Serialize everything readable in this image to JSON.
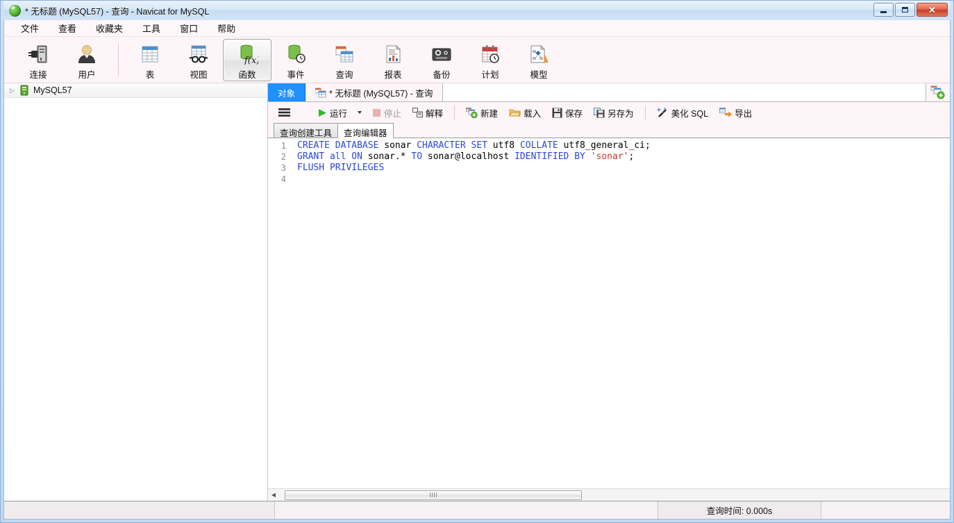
{
  "window": {
    "title": "* 无标题 (MySQL57) - 查询 - Navicat for MySQL",
    "logo_icon": "navicat-green-circle-icon",
    "controls": {
      "minimize": "minimize-icon",
      "maximize": "maximize-icon",
      "close": "close-icon"
    }
  },
  "menubar": {
    "items": [
      {
        "label": "文件"
      },
      {
        "label": "查看"
      },
      {
        "label": "收藏夹"
      },
      {
        "label": "工具"
      },
      {
        "label": "窗口"
      },
      {
        "label": "帮助"
      }
    ]
  },
  "toolbar": {
    "groups": [
      {
        "buttons": [
          {
            "label": "连接",
            "icon": "connection-plug-icon",
            "active": false
          },
          {
            "label": "用户",
            "icon": "user-icon",
            "active": false
          }
        ]
      },
      {
        "buttons": [
          {
            "label": "表",
            "icon": "table-grid-icon",
            "active": false
          },
          {
            "label": "视图",
            "icon": "view-glasses-icon",
            "active": false
          },
          {
            "label": "函数",
            "icon": "function-fx-icon",
            "active": true
          },
          {
            "label": "事件",
            "icon": "event-clock-icon",
            "active": false
          },
          {
            "label": "查询",
            "icon": "query-tables-icon",
            "active": false
          },
          {
            "label": "报表",
            "icon": "report-chart-icon",
            "active": false
          },
          {
            "label": "备份",
            "icon": "backup-tape-icon",
            "active": false
          },
          {
            "label": "计划",
            "icon": "schedule-calendar-icon",
            "active": false
          },
          {
            "label": "模型",
            "icon": "model-diagram-icon",
            "active": false
          }
        ]
      }
    ]
  },
  "sidebar": {
    "tree": [
      {
        "label": "MySQL57",
        "icon": "server-icon",
        "expander": "collapsed-arrow-icon",
        "expanded": false
      }
    ]
  },
  "tabstrip": {
    "tabs": [
      {
        "label": "对象",
        "state": "active-blue",
        "icon": null
      },
      {
        "label": "* 无标题 (MySQL57) - 查询",
        "state": "active-doc",
        "icon": "query-tables-icon"
      }
    ],
    "add_button": {
      "icon": "new-query-plus-icon",
      "title": "新建查询"
    }
  },
  "querybar": {
    "menu_button": {
      "icon": "hamburger-menu-icon"
    },
    "buttons": [
      {
        "label": "运行",
        "icon": "play-green-icon",
        "disabled": false,
        "has_caret": true
      },
      {
        "label": "停止",
        "icon": "stop-square-icon",
        "disabled": true,
        "has_caret": false
      },
      {
        "label": "解释",
        "icon": "explain-icon",
        "disabled": false,
        "has_caret": false
      },
      {
        "label": "新建",
        "icon": "new-doc-plus-icon",
        "disabled": false,
        "has_caret": false
      },
      {
        "label": "载入",
        "icon": "folder-open-icon",
        "disabled": false,
        "has_caret": false
      },
      {
        "label": "保存",
        "icon": "save-floppy-icon",
        "disabled": false,
        "has_caret": false
      },
      {
        "label": "另存为",
        "icon": "save-as-icon",
        "disabled": false,
        "has_caret": false
      },
      {
        "label": "美化 SQL",
        "icon": "magic-wand-icon",
        "disabled": false,
        "has_caret": false
      },
      {
        "label": "导出",
        "icon": "export-arrow-icon",
        "disabled": false,
        "has_caret": false
      }
    ]
  },
  "subtabs": {
    "tabs": [
      {
        "label": "查询创建工具",
        "active": false
      },
      {
        "label": "查询编辑器",
        "active": true
      }
    ]
  },
  "editor": {
    "line_numbers": [
      "1",
      "2",
      "3",
      "4"
    ],
    "lines": [
      {
        "n": 1,
        "tokens": [
          {
            "t": "CREATE",
            "c": "kw"
          },
          {
            "t": " ",
            "c": "pln"
          },
          {
            "t": "DATABASE",
            "c": "kw"
          },
          {
            "t": " sonar ",
            "c": "pln"
          },
          {
            "t": "CHARACTER",
            "c": "kw"
          },
          {
            "t": " ",
            "c": "pln"
          },
          {
            "t": "SET",
            "c": "kw"
          },
          {
            "t": " utf8 ",
            "c": "pln"
          },
          {
            "t": "COLLATE",
            "c": "kw"
          },
          {
            "t": " utf8_general_ci;",
            "c": "pln"
          }
        ]
      },
      {
        "n": 2,
        "tokens": [
          {
            "t": "GRANT",
            "c": "kw"
          },
          {
            "t": " ",
            "c": "pln"
          },
          {
            "t": "all",
            "c": "kw"
          },
          {
            "t": " ",
            "c": "pln"
          },
          {
            "t": "ON",
            "c": "kw"
          },
          {
            "t": " sonar.* ",
            "c": "pln"
          },
          {
            "t": "TO",
            "c": "kw"
          },
          {
            "t": " sonar@localhost ",
            "c": "pln"
          },
          {
            "t": "IDENTIFIED",
            "c": "kw"
          },
          {
            "t": " ",
            "c": "pln"
          },
          {
            "t": "BY",
            "c": "kw"
          },
          {
            "t": " ",
            "c": "pln"
          },
          {
            "t": "'sonar'",
            "c": "str"
          },
          {
            "t": ";",
            "c": "pln"
          }
        ]
      },
      {
        "n": 3,
        "tokens": [
          {
            "t": "FLUSH",
            "c": "kw"
          },
          {
            "t": " ",
            "c": "pln"
          },
          {
            "t": "PRIVILEGES",
            "c": "kw"
          }
        ]
      },
      {
        "n": 4,
        "tokens": []
      }
    ],
    "raw_sql": "CREATE DATABASE sonar CHARACTER SET utf8 COLLATE utf8_general_ci;\nGRANT all ON sonar.* TO sonar@localhost IDENTIFIED BY 'sonar';\nFLUSH PRIVILEGES\n"
  },
  "statusbar": {
    "cells": [
      {
        "text": ""
      },
      {
        "text": ""
      },
      {
        "text": "查询时间: 0.000s"
      },
      {
        "text": ""
      }
    ],
    "query_time": "查询时间: 0.000s"
  },
  "colors": {
    "accent_blue": "#1e90ff",
    "window_frame": "#cfe2f5",
    "toolbar_bg": "#fdf5f8",
    "keyword": "#2b47d6",
    "string": "#c0392b",
    "close_red": "#c83c22"
  }
}
